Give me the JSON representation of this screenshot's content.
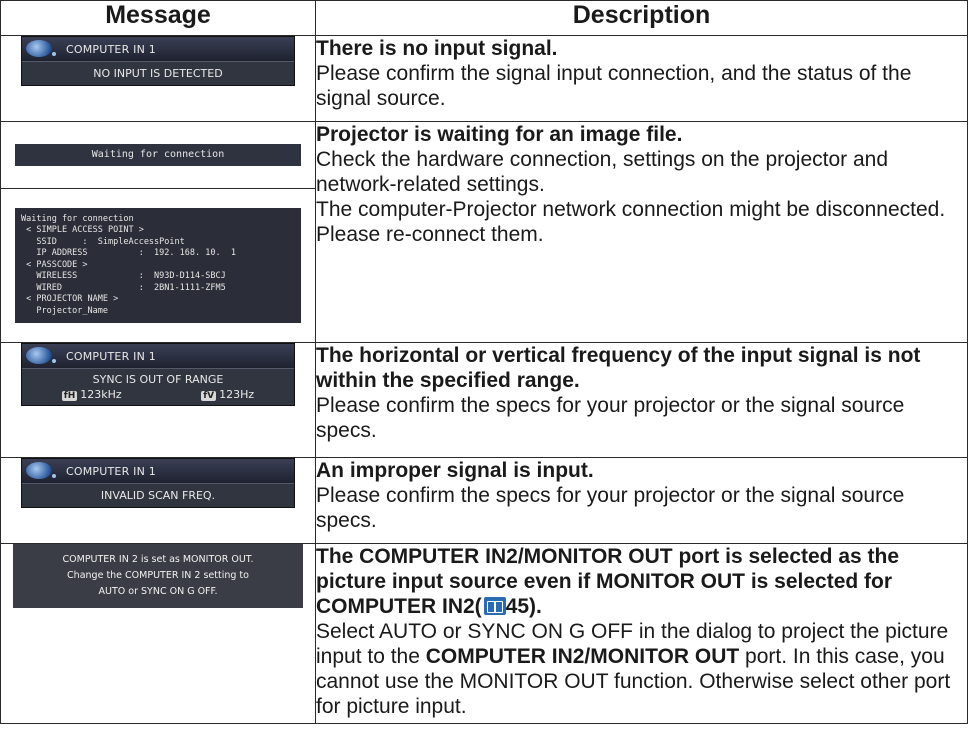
{
  "header": {
    "message": "Message",
    "description": "Description"
  },
  "rows": [
    {
      "osd": {
        "source": "COMPUTER IN 1",
        "text": "NO INPUT IS DETECTED"
      },
      "title": "There is no input signal.",
      "body": "Please confirm the signal input connection, and the status of the signal source."
    },
    {
      "wait_bar": "Waiting for connection",
      "wait_panel": [
        "Waiting for connection",
        " < SIMPLE ACCESS POINT >",
        "   SSID     :  SimpleAccessPoint",
        "   IP ADDRESS          :  192. 168. 10.  1",
        " < PASSCODE >",
        "   WIRELESS            :  N93D-D114-SBCJ",
        "   WIRED               :  2BN1-1111-ZFM5",
        " < PROJECTOR NAME >",
        "   Projector_Name"
      ],
      "title": "Projector is waiting for an image file.",
      "body": "Check the hardware connection, settings on the projector and network-related settings.",
      "body2": "The computer-Projector network connection might be disconnected. Please re-connect them."
    },
    {
      "osd": {
        "source": "COMPUTER IN 1",
        "text": "SYNC IS OUT OF RANGE",
        "fh_label": "fH",
        "fh": "123kHz",
        "fv_label": "fV",
        "fv": "123Hz"
      },
      "title": "The horizontal or vertical frequency of the input signal is not within the specified range.",
      "body": "Please confirm the specs for your projector or the signal source specs."
    },
    {
      "osd": {
        "source": "COMPUTER IN 1",
        "text": "INVALID SCAN FREQ."
      },
      "title": "An improper signal is input.",
      "body": "Please confirm the specs for your projector or the signal source specs."
    },
    {
      "dark_lines": [
        "COMPUTER IN 2 is set as MONITOR OUT.",
        "Change the COMPUTER IN 2 setting to",
        "AUTO or SYNC ON G OFF."
      ],
      "title_a": "The COMPUTER IN2/MONITOR OUT port is selected as the picture input source even if MONITOR OUT is selected for COMPUTER IN2(",
      "title_ref": "45",
      "title_b": ").",
      "body_a": "Select AUTO or SYNC ON G OFF in the dialog to project the picture input to the ",
      "body_bold": "COMPUTER IN2/MONITOR OUT",
      "body_b": " port. In this case, you cannot use the MONITOR OUT function. Otherwise select other port for picture input."
    }
  ]
}
